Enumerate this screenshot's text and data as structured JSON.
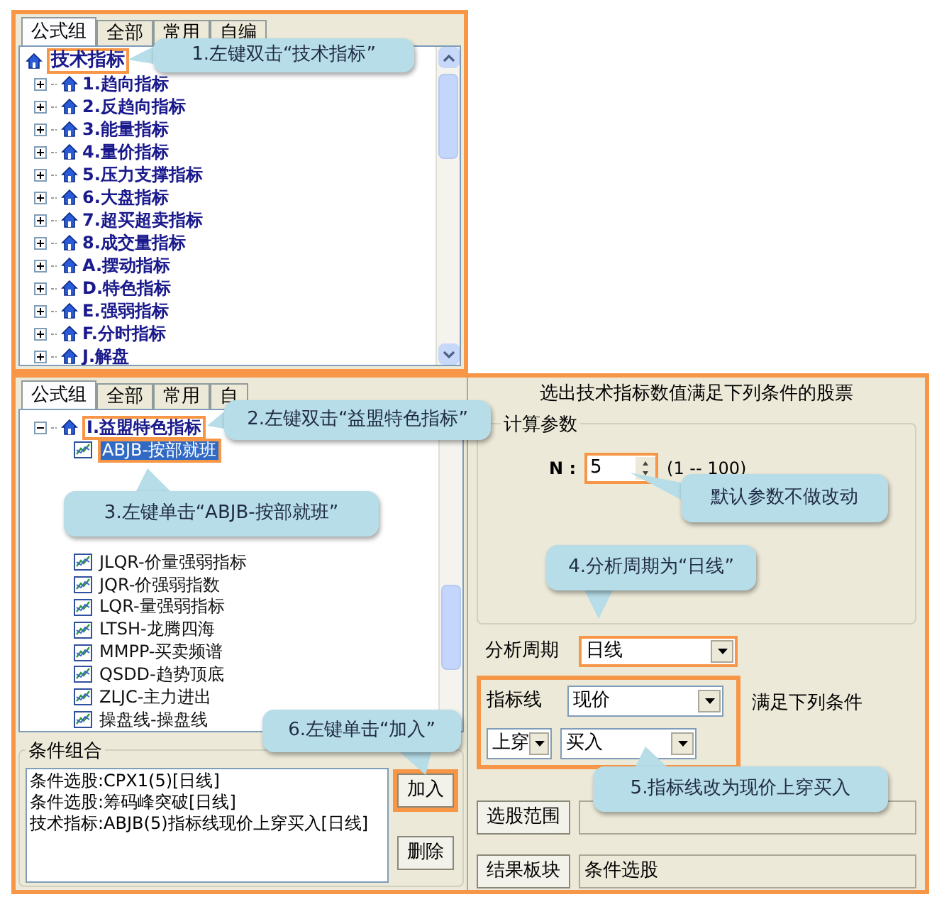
{
  "top_panel": {
    "tabs": [
      {
        "label": "公式组",
        "selected": true
      },
      {
        "label": "全部",
        "selected": false
      },
      {
        "label": "常用",
        "selected": false
      },
      {
        "label": "自编",
        "selected": false
      }
    ],
    "tree": {
      "label": "技术指标",
      "highlighted": true,
      "children": [
        {
          "label": "1.趋向指标",
          "expanded": false
        },
        {
          "label": "2.反趋向指标",
          "expanded": false
        },
        {
          "label": "3.能量指标",
          "expanded": false
        },
        {
          "label": "4.量价指标",
          "expanded": false
        },
        {
          "label": "5.压力支撑指标",
          "expanded": false
        },
        {
          "label": "6.大盘指标",
          "expanded": false
        },
        {
          "label": "7.超买超卖指标",
          "expanded": false
        },
        {
          "label": "8.成交量指标",
          "expanded": false
        },
        {
          "label": "A.摆动指标",
          "expanded": false
        },
        {
          "label": "D.特色指标",
          "expanded": false
        },
        {
          "label": "E.强弱指标",
          "expanded": false
        },
        {
          "label": "F.分时指标",
          "expanded": false
        },
        {
          "label": "J.解盘",
          "expanded": false
        }
      ]
    }
  },
  "bottom_panel": {
    "tabs": [
      {
        "label": "公式组",
        "selected": true
      },
      {
        "label": "全部",
        "selected": false
      },
      {
        "label": "常用",
        "selected": false
      },
      {
        "label": "自",
        "selected": false
      }
    ],
    "tree": {
      "label": "I.益盟特色指标",
      "expanded": true,
      "highlighted": true,
      "children": [
        {
          "label": "ABJB-按部就班",
          "selected": true,
          "highlighted": true
        },
        {
          "label": "JLQR-价量强弱指标",
          "selected": false,
          "highlighted": false
        },
        {
          "label": "JQR-价强弱指数",
          "selected": false,
          "highlighted": false
        },
        {
          "label": "LQR-量强弱指标",
          "selected": false,
          "highlighted": false
        },
        {
          "label": "LTSH-龙腾四海",
          "selected": false,
          "highlighted": false
        },
        {
          "label": "MMPP-买卖频谱",
          "selected": false,
          "highlighted": false
        },
        {
          "label": "QSDD-趋势顶底",
          "selected": false,
          "highlighted": false
        },
        {
          "label": "ZLJC-主力进出",
          "selected": false,
          "highlighted": false
        },
        {
          "label": "操盘线-操盘线",
          "selected": false,
          "highlighted": false
        }
      ]
    }
  },
  "combination": {
    "title": "条件组合",
    "lines": [
      "条件选股:CPX1(5)[日线]",
      "条件选股:筹码峰突破[日线]",
      "技术指标:ABJB(5)指标线现价上穿买入[日线]"
    ],
    "buttons": [
      {
        "label": "加入",
        "highlighted": true
      },
      {
        "label": "删除",
        "highlighted": false
      }
    ]
  },
  "criteria": {
    "heading": "选出技术指标数值满足下列条件的股票",
    "params": {
      "title": "计算参数",
      "name": "N :",
      "value": "5",
      "range": "(1 -- 100)",
      "highlighted": true
    },
    "period": {
      "label": "分析周期",
      "value": "日线",
      "highlighted": true
    },
    "condition": {
      "line_label": "指标线",
      "line_value": "现价",
      "suffix": "满足下列条件",
      "cross_value": "上穿",
      "signal_value": "买入",
      "highlighted": true
    },
    "range_button": "选股范围",
    "result_button": "结果板块",
    "result_value": "条件选股"
  },
  "callouts": [
    {
      "text": "1.左键双击“技术指标”"
    },
    {
      "text": "2.左键双击“益盟特色指标”"
    },
    {
      "text": "3.左键单击“ABJB-按部就班”"
    },
    {
      "text": "默认参数不做改动"
    },
    {
      "text": "4.分析周期为“日线”"
    },
    {
      "text": "5.指标线改为现价上穿买入"
    },
    {
      "text": "6.左键单击“加入”"
    }
  ]
}
